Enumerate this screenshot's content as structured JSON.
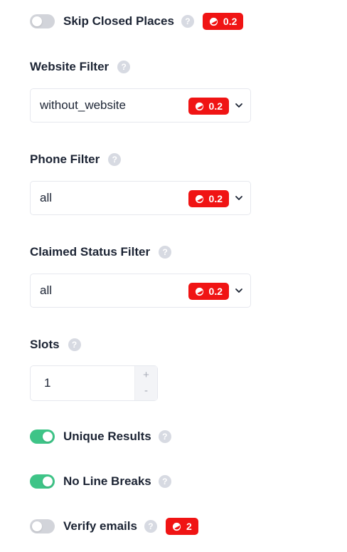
{
  "skip_closed": {
    "label": "Skip Closed Places",
    "help": "?",
    "badge": "0.2",
    "enabled": false
  },
  "website_filter": {
    "label": "Website Filter",
    "help": "?",
    "value": "without_website",
    "badge": "0.2"
  },
  "phone_filter": {
    "label": "Phone Filter",
    "help": "?",
    "value": "all",
    "badge": "0.2"
  },
  "claimed_filter": {
    "label": "Claimed Status Filter",
    "help": "?",
    "value": "all",
    "badge": "0.2"
  },
  "slots": {
    "label": "Slots",
    "help": "?",
    "value": "1",
    "increment": "+",
    "decrement": "-"
  },
  "unique_results": {
    "label": "Unique Results",
    "help": "?",
    "enabled": true
  },
  "no_line_breaks": {
    "label": "No Line Breaks",
    "help": "?",
    "enabled": true
  },
  "verify_emails": {
    "label": "Verify emails",
    "help": "?",
    "badge": "2",
    "enabled": false
  },
  "icons": {
    "coin": "coin-icon",
    "help": "help-icon",
    "chevron": "chevron-down-icon"
  },
  "colors": {
    "badge": "#f01414",
    "toggle_on": "#3ec487",
    "toggle_off": "#d2d4da",
    "text": "#1c2434"
  }
}
